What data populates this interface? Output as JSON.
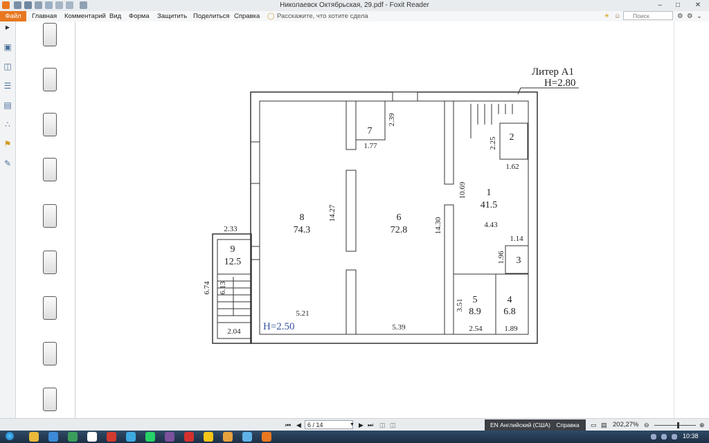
{
  "window": {
    "title": "Николаевск Октябрьская, 29.pdf - Foxit Reader",
    "minimize": "–",
    "maximize": "□",
    "close": "✕"
  },
  "ribbon": {
    "file_tab": "Файл",
    "tabs": [
      "Главная",
      "Комментарий",
      "Вид",
      "Форма",
      "Защитить",
      "Поделиться",
      "Справка"
    ],
    "tell_me": "Расскажите, что хотите сдела",
    "search_placeholder": "Поиск"
  },
  "sidebar": {
    "icons": [
      "page-thumbnail-icon",
      "layers-icon",
      "bookmarks-icon",
      "comments-icon",
      "attachments-icon",
      "security-icon",
      "signature-icon"
    ]
  },
  "floorplan": {
    "liter": "Литер А1",
    "height_main": "Н=2.80",
    "height_left": "Н=2.50",
    "rooms": [
      {
        "num": "1",
        "area": "41.5"
      },
      {
        "num": "2",
        "area": ""
      },
      {
        "num": "3",
        "area": ""
      },
      {
        "num": "4",
        "area": "6.8"
      },
      {
        "num": "5",
        "area": "8.9"
      },
      {
        "num": "6",
        "area": "72.8"
      },
      {
        "num": "7",
        "area": ""
      },
      {
        "num": "8",
        "area": "74.3"
      },
      {
        "num": "9",
        "area": "12.5"
      }
    ],
    "dims": {
      "d_2_39": "2.39",
      "d_1_77": "1.77",
      "d_2_25": "2.25",
      "d_1_62": "1.62",
      "d_10_69": "10.69",
      "d_14_27": "14.27",
      "d_14_30": "14.30",
      "d_4_43": "4.43",
      "d_1_14": "1.14",
      "d_1_96": "1.96",
      "d_2_33": "2.33",
      "d_6_74": "6.74",
      "d_6_13": "6.13",
      "d_5_21": "5.21",
      "d_5_39": "5.39",
      "d_3_51": "3.51",
      "d_2_54": "2.54",
      "d_1_89": "1.89",
      "d_2_04": "2.04"
    }
  },
  "status": {
    "page_display": "6 / 14",
    "language": "EN Английский (США)",
    "help": "Справка",
    "zoom": "202,27%"
  },
  "taskbar": {
    "time": "10:38"
  }
}
